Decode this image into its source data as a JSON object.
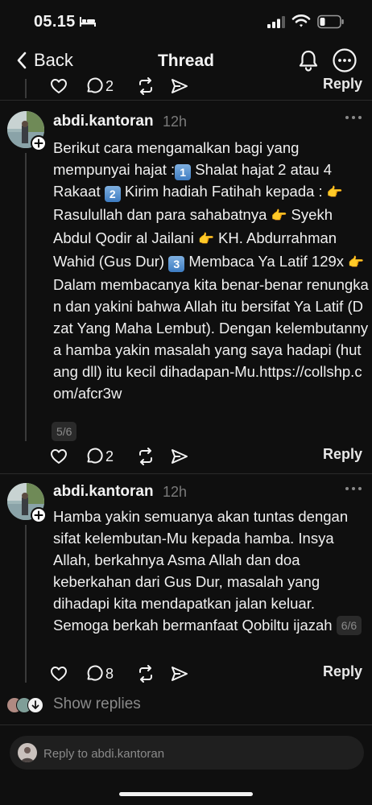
{
  "status": {
    "time": "05.15"
  },
  "nav": {
    "back_label": "Back",
    "title": "Thread"
  },
  "top_actions": {
    "reply_count": "2",
    "reply_label": "Reply"
  },
  "posts": [
    {
      "username": "abdi.kantoran",
      "time": "12h",
      "text_parts": [
        "Berikut cara mengamalkan bagi yang mempunyai hajat :",
        "1",
        " Shalat hajat 2 atau 4 Rakaat ",
        "2",
        " Kirim hadiah Fatihah kepada : ",
        "👉",
        " Rasulullah dan para sahabatnya ",
        "👉",
        " Syekh Abdul Qodir al Jailani ",
        "👉",
        " KH. Abdurrahman Wahid (Gus Dur) ",
        "3",
        " Membaca Ya Latif 129x ",
        "👉",
        " Dalam membacanya kita benar-benar renungkan dan yakini bahwa Allah itu bersifat Ya Latif (Dzat Yang Maha Lembut). Dengan kelembutannya hamba yakin masalah yang saya hadapi (hutang dll) itu kecil dihadapan-Mu.https://collshp.com/afcr3w"
      ],
      "page": "5/6",
      "reply_count": "2",
      "reply_label": "Reply"
    },
    {
      "username": "abdi.kantoran",
      "time": "12h",
      "text": "Hamba yakin semuanya akan tuntas dengan sifat kelembutan-Mu kepada hamba. Insya Allah, berkahnya Asma Allah dan doa keberkahan dari Gus Dur, masalah yang dihadapi kita mendapatkan jalan keluar. Semoga berkah bermanfaat Qobiltu ijazah",
      "page": "6/6",
      "reply_count": "8",
      "reply_label": "Reply"
    }
  ],
  "show_replies": {
    "label": "Show replies"
  },
  "composer": {
    "placeholder": "Reply to abdi.kantoran"
  },
  "colors": {
    "background": "#0f0f0f",
    "text": "#f3f3f3",
    "muted": "#7a7a7a",
    "badge": "#2a2a2a"
  }
}
